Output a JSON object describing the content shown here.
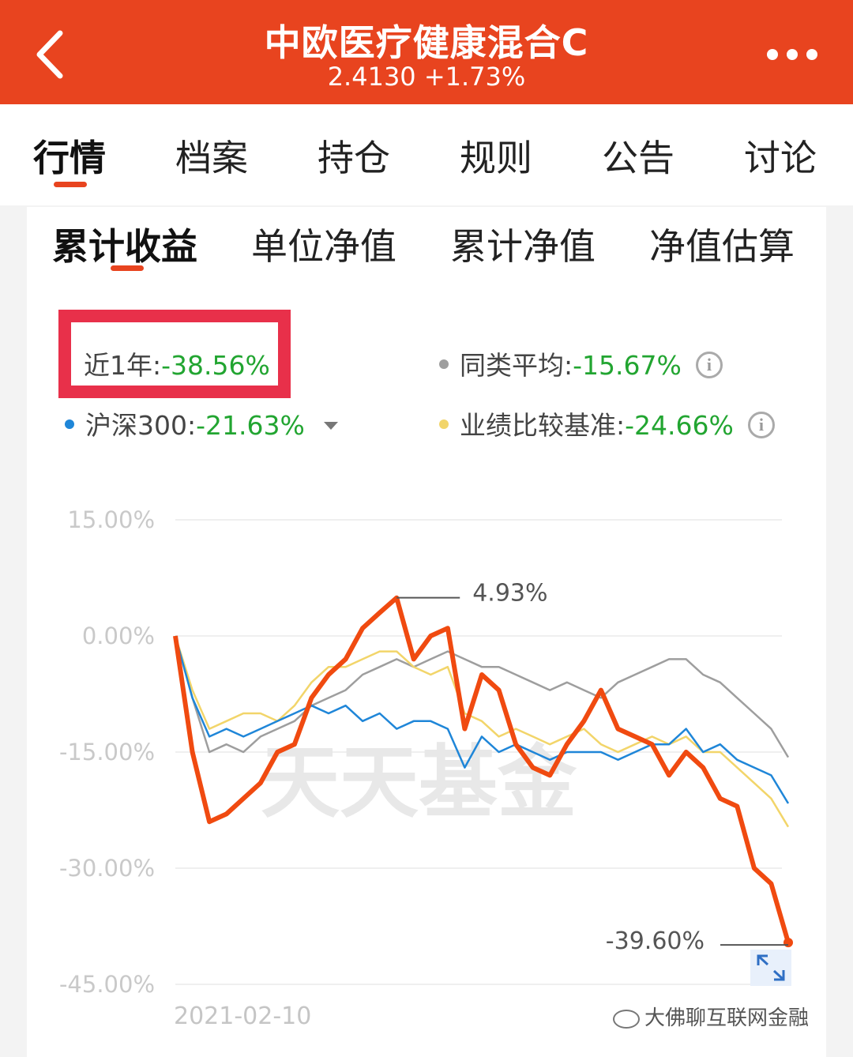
{
  "header": {
    "title": "中欧医疗健康混合C",
    "subtitle": "2.4130 +1.73%",
    "back_icon": "chevron-left-icon",
    "more_icon": "more-dots-icon"
  },
  "tabs": [
    {
      "label": "行情",
      "active": true
    },
    {
      "label": "档案",
      "active": false
    },
    {
      "label": "持仓",
      "active": false
    },
    {
      "label": "规则",
      "active": false
    },
    {
      "label": "公告",
      "active": false
    },
    {
      "label": "讨论",
      "active": false
    }
  ],
  "subtabs": [
    {
      "label": "累计收益",
      "active": true
    },
    {
      "label": "单位净值",
      "active": false
    },
    {
      "label": "累计净值",
      "active": false
    },
    {
      "label": "净值估算",
      "active": false
    }
  ],
  "legend": {
    "fund": {
      "label": "近1年:",
      "value": "-38.56%"
    },
    "peer_avg": {
      "label": "同类平均:",
      "value": "-15.67%",
      "color": "#9e9e9e"
    },
    "hs300": {
      "label": "沪深300:",
      "value": "-21.63%",
      "color": "#1f86d8"
    },
    "benchmark": {
      "label": "业绩比较基准:",
      "value": "-24.66%",
      "color": "#f2d56a"
    }
  },
  "colors": {
    "accent": "#e8441f",
    "highlight_box": "#e8304a",
    "fund_line": "#f04a10",
    "negative_value": "#22a531"
  },
  "watermark": "天天基金",
  "wechat_mark": "大佛聊互联网金融",
  "chart_data": {
    "type": "line",
    "yticks": [
      "15.00%",
      "0.00%",
      "-15.00%",
      "-30.00%",
      "-45.00%"
    ],
    "ylim": [
      -45,
      15
    ],
    "x_start_label": "2021-02-10",
    "annotations": {
      "max_label": "4.93%",
      "last_label": "-39.60%"
    },
    "series": [
      {
        "name": "近1年",
        "color": "#f04a10",
        "values": [
          0,
          -15,
          -24,
          -23,
          -21,
          -19,
          -15,
          -14,
          -8,
          -5,
          -3,
          1,
          3,
          4.93,
          -3,
          0,
          1,
          -12,
          -5,
          -7,
          -14,
          -17,
          -18,
          -14,
          -11,
          -7,
          -12,
          -13,
          -14,
          -18,
          -15,
          -17,
          -21,
          -22,
          -30,
          -32,
          -39.6
        ]
      },
      {
        "name": "同类平均",
        "color": "#9e9e9e",
        "values": [
          0,
          -8,
          -15,
          -14,
          -15,
          -13,
          -12,
          -11,
          -9,
          -8,
          -7,
          -5,
          -4,
          -3,
          -4,
          -3,
          -2,
          -3,
          -4,
          -4,
          -5,
          -6,
          -7,
          -6,
          -7,
          -8,
          -6,
          -5,
          -4,
          -3,
          -3,
          -5,
          -6,
          -8,
          -10,
          -12,
          -15.67
        ]
      },
      {
        "name": "沪深300",
        "color": "#1f86d8",
        "values": [
          0,
          -8,
          -13,
          -12,
          -13,
          -12,
          -11,
          -10,
          -9,
          -10,
          -9,
          -11,
          -10,
          -12,
          -11,
          -11,
          -12,
          -17,
          -13,
          -15,
          -14,
          -15,
          -16,
          -15,
          -15,
          -15,
          -16,
          -15,
          -14,
          -14,
          -12,
          -15,
          -14,
          -16,
          -17,
          -18,
          -21.63
        ]
      },
      {
        "name": "业绩比较基准",
        "color": "#f2d56a",
        "values": [
          0,
          -7,
          -12,
          -11,
          -10,
          -10,
          -11,
          -9,
          -6,
          -4,
          -4,
          -3,
          -2,
          -2,
          -4,
          -5,
          -4,
          -10,
          -11,
          -13,
          -12,
          -13,
          -14,
          -13,
          -12,
          -14,
          -15,
          -14,
          -13,
          -14,
          -13,
          -15,
          -15,
          -17,
          -19,
          -21,
          -24.66
        ]
      }
    ]
  }
}
